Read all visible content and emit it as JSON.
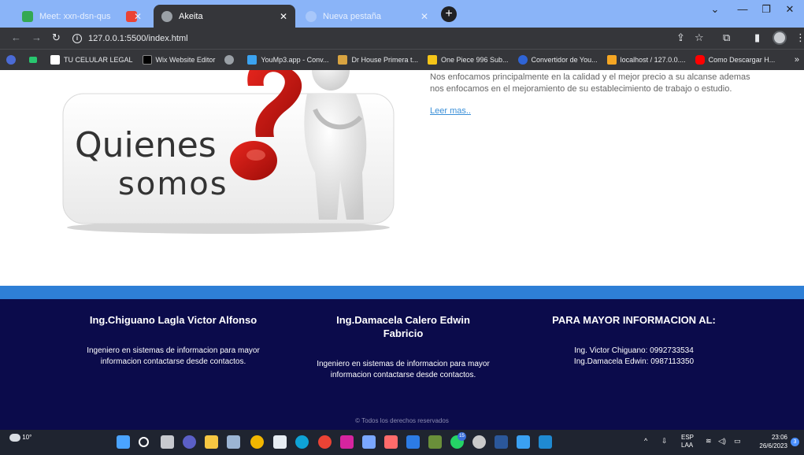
{
  "browser": {
    "tabs": [
      {
        "title": "Meet: xxn-dsn-qus",
        "active": false
      },
      {
        "title": "",
        "active": false
      },
      {
        "title": "Akeita",
        "active": true
      },
      {
        "title": "Nueva pestaña",
        "active": false
      }
    ],
    "url": "127.0.0.1:5500/index.html",
    "bookmarks": [
      "TU CELULAR LEGAL",
      "Wix Website Editor",
      "",
      "YouMp3.app - Conv...",
      "Dr House Primera t...",
      "One Piece 996 Sub...",
      "Convertidor de You...",
      "localhost / 127.0.0....",
      "Como Descargar H..."
    ]
  },
  "about": {
    "image_line1": "Quienes",
    "image_line2": "somos",
    "text": "Nos enfocamos principalmente en la calidad y el mejor precio a su alcanse ademas nos enfocamos en el mejoramiento de su establecimiento de trabajo o estudio.",
    "link": "Leer mas.."
  },
  "footer": {
    "col1": {
      "title": "Ing.Chiguano Lagla Victor Alfonso",
      "text": "Ingeniero en sistemas de informacion para mayor informacion contactarse desde contactos."
    },
    "col2": {
      "title": "Ing.Damacela Calero Edwin Fabricio",
      "text": "Ingeniero en sistemas de informacion para mayor informacion contactarse desde contactos."
    },
    "col3": {
      "title": "PARA MAYOR INFORMACION AL:",
      "line1": "Ing. Victor Chiguano: 0992733534",
      "line2": "Ing.Damacela Edwin: 0987113350"
    },
    "copyright": "© Todos los derechos reservados"
  },
  "taskbar": {
    "weather": "10°",
    "lang": "ESP",
    "layout": "LAA",
    "time": "23:06",
    "date": "26/6/2023",
    "notifications": "3",
    "badge": "15"
  },
  "colors": {
    "footer_bg": "#0b0b4b",
    "accent_bar": "#2e7fd6",
    "link": "#3a8fd8"
  }
}
